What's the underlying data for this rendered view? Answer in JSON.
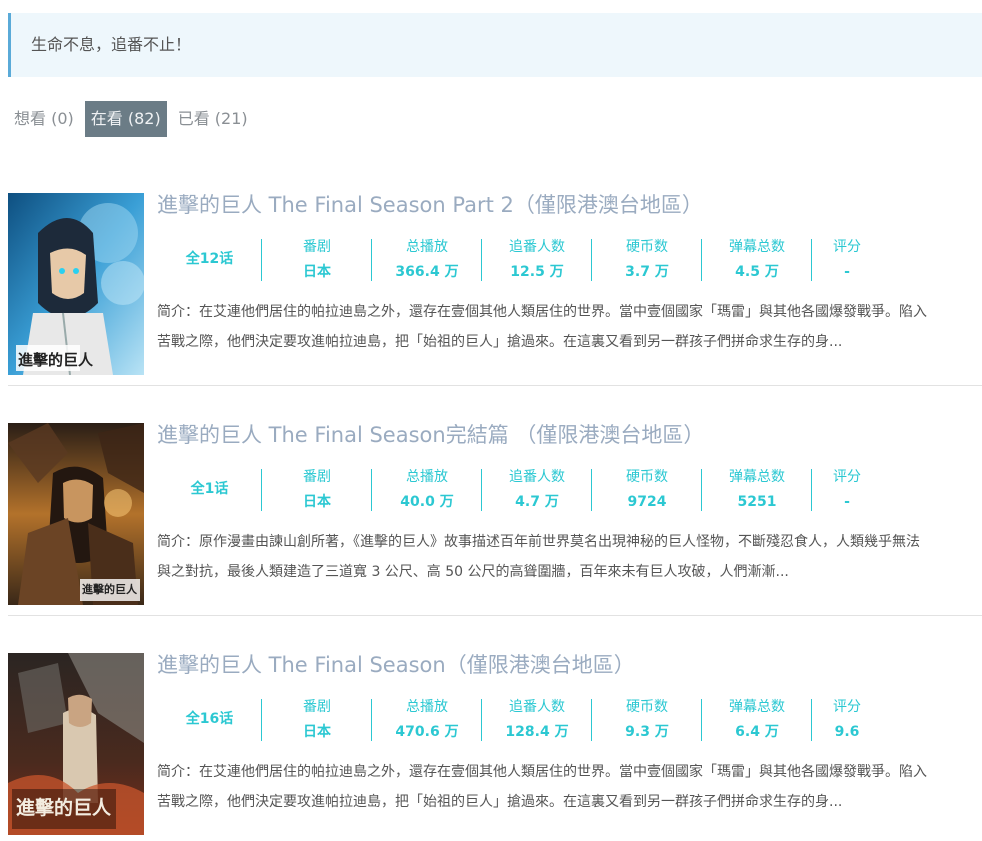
{
  "notice": "生命不息，追番不止！",
  "tabs": [
    {
      "label": "想看 (0)",
      "active": false
    },
    {
      "label": "在看 (82)",
      "active": true
    },
    {
      "label": "已看 (21)",
      "active": false
    }
  ],
  "stat_labels": {
    "area": "番剧",
    "plays": "总播放",
    "follows": "追番人数",
    "coins": "硬币数",
    "danmaku": "弹幕总数",
    "score": "评分"
  },
  "items": [
    {
      "title": "進擊的巨人 The Final Season Part 2（僅限港澳台地區）",
      "episodes": "全12话",
      "area": "日本",
      "plays": "366.4 万",
      "follows": "12.5 万",
      "coins": "3.7 万",
      "danmaku": "4.5 万",
      "score": "-",
      "desc_line1": "简介：在艾連他們居住的帕拉迪島之外，還存在壹個其他人類居住的世界。當中壹個國家「瑪雷」與其他各國爆發戰爭。陷入",
      "desc_line2": "苦戰之際，他們決定要攻進帕拉迪島，把「始祖的巨人」搶過來。在這裏又看到另一群孩子們拼命求生存的身...",
      "cover_logo": "進擊的巨人",
      "cover_colors": [
        "#1a6fa8",
        "#79c3e6"
      ]
    },
    {
      "title": "進擊的巨人 The Final Season完結篇 （僅限港澳台地區）",
      "episodes": "全1话",
      "area": "日本",
      "plays": "40.0 万",
      "follows": "4.7 万",
      "coins": "9724",
      "danmaku": "5251",
      "score": "-",
      "desc_line1": "简介：原作漫畫由諫山創所著，《進擊的巨人》故事描述百年前世界莫名出現神秘的巨人怪物，不斷殘忍食人，人類幾乎無法",
      "desc_line2": "與之對抗，最後人類建造了三道寬 3 公尺、高 50 公尺的高聳圍牆，百年來未有巨人攻破，人們漸漸...",
      "cover_logo": "進擊的巨人",
      "cover_colors": [
        "#3a2a1e",
        "#c9822e"
      ]
    },
    {
      "title": "進擊的巨人 The Final Season（僅限港澳台地區）",
      "episodes": "全16话",
      "area": "日本",
      "plays": "470.6 万",
      "follows": "128.4 万",
      "coins": "9.3 万",
      "danmaku": "6.4 万",
      "score": "9.6",
      "desc_line1": "简介：在艾連他們居住的帕拉迪島之外，還存在壹個其他人類居住的世界。當中壹個國家「瑪雷」與其他各國爆發戰爭。陷入",
      "desc_line2": "苦戰之際，他們決定要攻進帕拉迪島，把「始祖的巨人」搶過來。在這裏又看到另一群孩子們拼命求生存的身...",
      "cover_logo": "進擊的巨人",
      "cover_colors": [
        "#1c1a18",
        "#b0462a"
      ]
    }
  ]
}
